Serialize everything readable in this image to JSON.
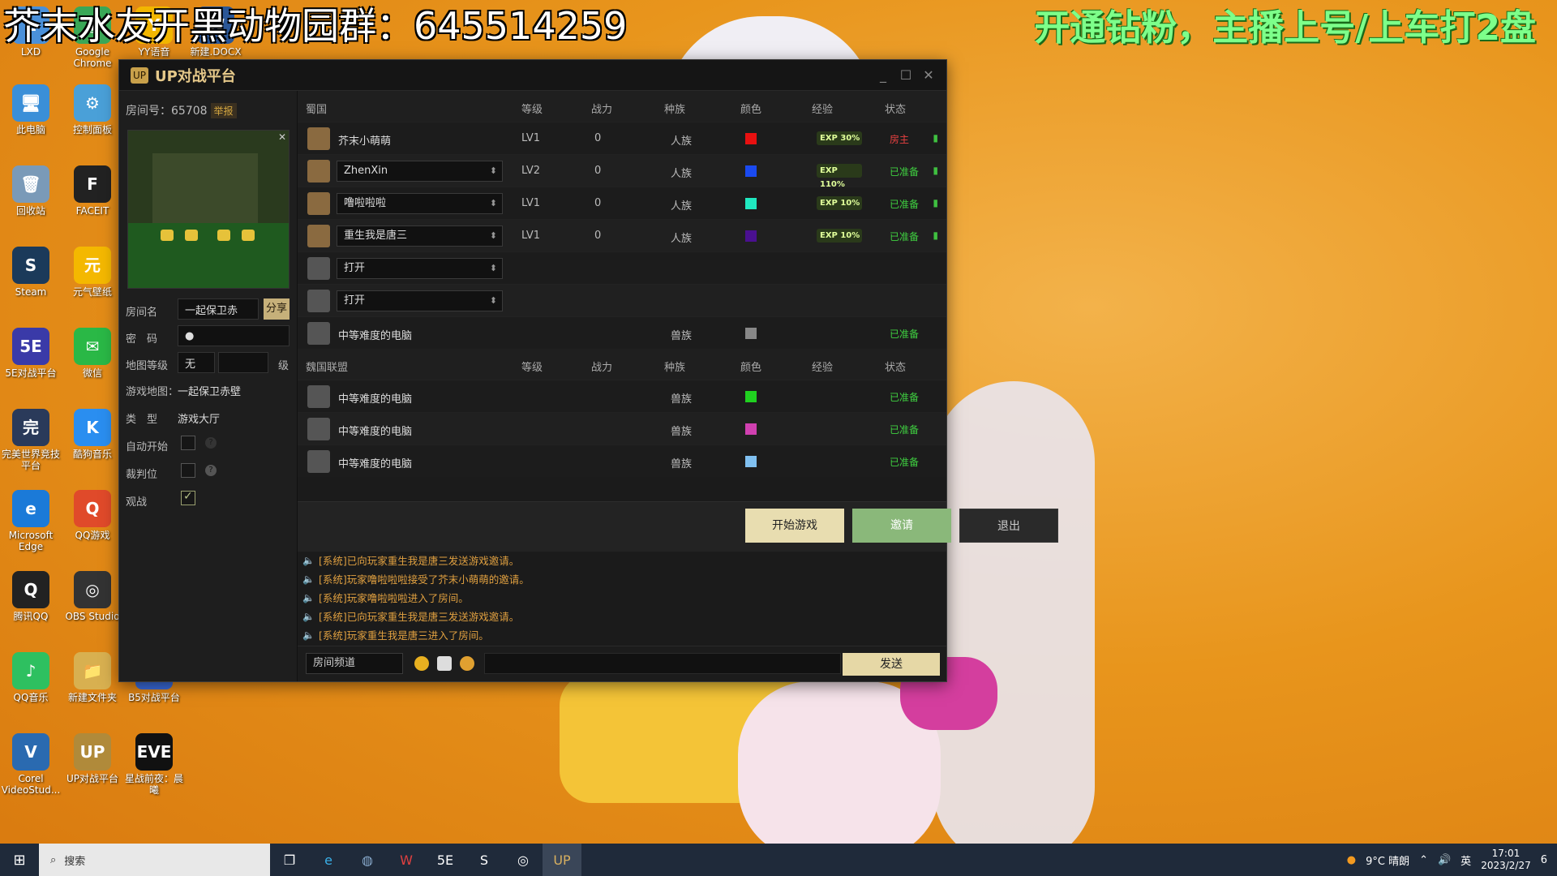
{
  "overlay": {
    "left_text": "芥末水友开黑动物园群：645514259",
    "right_text": "开通钻粉，主播上号/上车打2盘"
  },
  "desktop_icons": [
    {
      "label": "LXD",
      "color": "#4a90d9",
      "glyph": "L"
    },
    {
      "label": "Google Chrome",
      "color": "#3aa757",
      "glyph": "◉"
    },
    {
      "label": "YY语音",
      "color": "#f2b600",
      "glyph": "Y"
    },
    {
      "label": "新建.DOCX",
      "color": "#2b5797",
      "glyph": "W"
    },
    {
      "label": "此电脑",
      "color": "#3a8fd8",
      "glyph": "🖥"
    },
    {
      "label": "控制面板",
      "color": "#4aa0d8",
      "glyph": "⚙"
    },
    {
      "label": "回收站",
      "color": "#7a9ab8",
      "glyph": "🗑"
    },
    {
      "label": "FACEIT",
      "color": "#222",
      "glyph": "F"
    },
    {
      "label": "Steam",
      "color": "#1b3a5a",
      "glyph": "S"
    },
    {
      "label": "元气壁纸",
      "color": "#f4b800",
      "glyph": "元"
    },
    {
      "label": "5E对战平台",
      "color": "#3a3aa8",
      "glyph": "5E"
    },
    {
      "label": "微信",
      "color": "#2ab846",
      "glyph": "✉"
    },
    {
      "label": "完美世界竞技平台",
      "color": "#2a3a5a",
      "glyph": "完"
    },
    {
      "label": "酷狗音乐",
      "color": "#2a8ef0",
      "glyph": "K"
    },
    {
      "label": "Microsoft Edge",
      "color": "#1b7ad8",
      "glyph": "e"
    },
    {
      "label": "QQ游戏",
      "color": "#e04a2a",
      "glyph": "Q"
    },
    {
      "label": "腾讯QQ",
      "color": "#222",
      "glyph": "Q"
    },
    {
      "label": "OBS Studio",
      "color": "#333",
      "glyph": "◎"
    },
    {
      "label": "QQ音乐",
      "color": "#2ec060",
      "glyph": "♪"
    },
    {
      "label": "新建文件夹",
      "color": "#d8b050",
      "glyph": "📁"
    },
    {
      "label": "B5对战平台",
      "color": "#3a6ad8",
      "glyph": "B5"
    },
    {
      "label": "Corel VideoStud...",
      "color": "#2a6ab0",
      "glyph": "V"
    },
    {
      "label": "UP对战平台",
      "color": "#b08a3a",
      "glyph": "UP"
    },
    {
      "label": "星战前夜：晨曦",
      "color": "#111",
      "glyph": "EVE"
    }
  ],
  "window": {
    "title": "UP对战平台",
    "min": "_",
    "max": "☐",
    "close": "✕"
  },
  "room": {
    "number_label": "房间号：65708",
    "report": "举报",
    "name_label": "房间名",
    "name_value": "一起保卫赤",
    "share": "分享",
    "pwd_label": "密　码",
    "pwd_value": "●",
    "maplevel_label": "地图等级",
    "maplevel_value": "无",
    "level_unit": "级",
    "gamemap_label": "游戏地图：",
    "gamemap_value": "一起保卫赤壁",
    "type_label": "类　型",
    "type_value": "游戏大厅",
    "autostart_label": "自动开始",
    "referee_label": "裁判位",
    "spectate_label": "观战"
  },
  "team1": {
    "header": [
      "蜀国",
      "等级",
      "战力",
      "种族",
      "颜色",
      "经验",
      "状态"
    ],
    "rows": [
      {
        "name": "芥末小萌萌",
        "level": "LV1",
        "power": "0",
        "race": "人族",
        "color": "#e81010",
        "exp": "EXP 30%",
        "status": "房主",
        "status_color": "#e84040",
        "select": false,
        "avatar": true
      },
      {
        "name": "ZhenXin",
        "level": "LV2",
        "power": "0",
        "race": "人族",
        "color": "#1a4af0",
        "exp": "EXP 110%",
        "status": "已准备",
        "status_color": "#3fd040",
        "select": true,
        "avatar": true
      },
      {
        "name": "噜啦啦啦",
        "level": "LV1",
        "power": "0",
        "race": "人族",
        "color": "#20e8c0",
        "exp": "EXP 10%",
        "status": "已准备",
        "status_color": "#3fd040",
        "select": true,
        "avatar": true
      },
      {
        "name": "重生我是唐三",
        "level": "LV1",
        "power": "0",
        "race": "人族",
        "color": "#4a1090",
        "exp": "EXP 10%",
        "status": "已准备",
        "status_color": "#3fd040",
        "select": true,
        "avatar": true
      },
      {
        "name": "打开",
        "level": "",
        "power": "",
        "race": "",
        "color": "",
        "exp": "",
        "status": "",
        "status_color": "",
        "select": true,
        "avatar": false
      },
      {
        "name": "打开",
        "level": "",
        "power": "",
        "race": "",
        "color": "",
        "exp": "",
        "status": "",
        "status_color": "",
        "select": true,
        "avatar": false
      },
      {
        "name": "中等难度的电脑",
        "level": "",
        "power": "",
        "race": "兽族",
        "color": "#888888",
        "exp": "",
        "status": "已准备",
        "status_color": "#3fd040",
        "select": false,
        "avatar": false
      }
    ]
  },
  "team2": {
    "header": [
      "魏国联盟",
      "等级",
      "战力",
      "种族",
      "颜色",
      "经验",
      "状态"
    ],
    "rows": [
      {
        "name": "中等难度的电脑",
        "race": "兽族",
        "color": "#20d020",
        "status": "已准备"
      },
      {
        "name": "中等难度的电脑",
        "race": "兽族",
        "color": "#d040b0",
        "status": "已准备"
      },
      {
        "name": "中等难度的电脑",
        "race": "兽族",
        "color": "#80c0f0",
        "status": "已准备"
      }
    ]
  },
  "actions": {
    "start": "开始游戏",
    "invite": "邀请",
    "exit": "退出"
  },
  "log": [
    "[系统]已向玩家重生我是唐三发送游戏邀请。",
    "[系统]玩家噜啦啦啦接受了芥末小萌萌的邀请。",
    "[系统]玩家噜啦啦啦进入了房间。",
    "[系统]已向玩家重生我是唐三发送游戏邀请。",
    "[系统]玩家重生我是唐三进入了房间。"
  ],
  "chat": {
    "channel": "房间频道",
    "send": "发送"
  },
  "taskbar": {
    "search": "搜索",
    "weather": "9°C 晴朗",
    "ime": "英",
    "time": "17:01",
    "date": "2023/2/27",
    "notif": "6"
  }
}
